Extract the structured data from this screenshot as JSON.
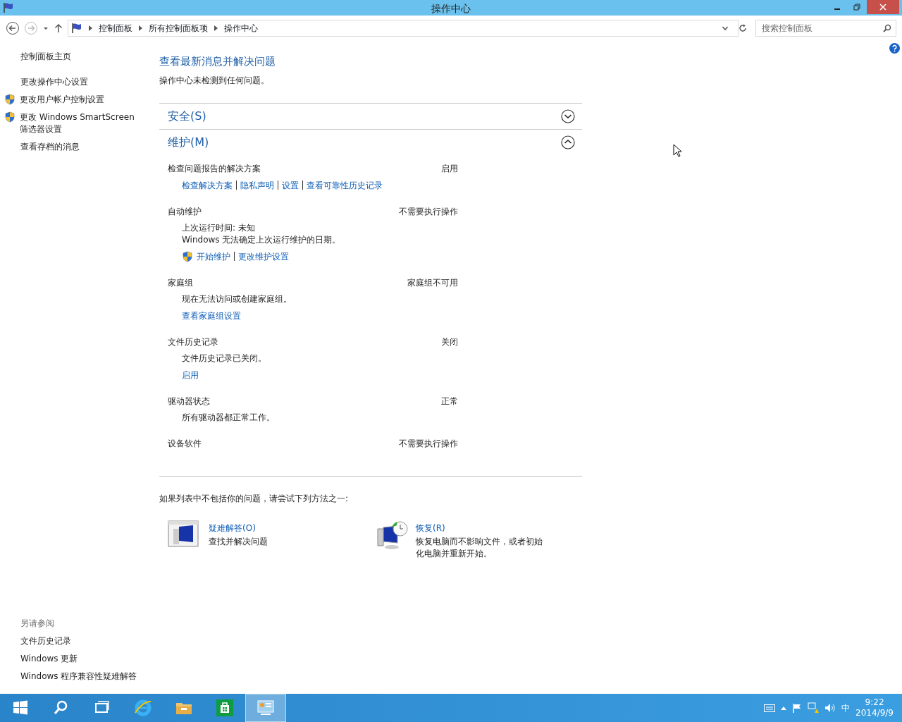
{
  "window": {
    "title": "操作中心"
  },
  "address_bar": {
    "crumbs": [
      "控制面板",
      "所有控制面板项",
      "操作中心"
    ]
  },
  "search": {
    "placeholder": "搜索控制面板"
  },
  "sidebar": {
    "home": "控制面板主页",
    "items": [
      {
        "label": "更改操作中心设置",
        "shield": false
      },
      {
        "label": "更改用户帐户控制设置",
        "shield": true
      },
      {
        "label": "更改 Windows SmartScreen 筛选器设置",
        "shield": true
      },
      {
        "label": "查看存档的消息",
        "shield": false
      }
    ],
    "see_also": {
      "title": "另请参阅",
      "items": [
        "文件历史记录",
        "Windows 更新",
        "Windows 程序兼容性疑难解答"
      ]
    }
  },
  "main": {
    "heading": "查看最新消息并解决问题",
    "subtitle": "操作中心未检测到任何问题。",
    "sections": [
      {
        "title": "安全(S)",
        "expanded": false
      },
      {
        "title": "维护(M)",
        "expanded": true,
        "items": [
          {
            "title": "检查问题报告的解决方案",
            "status": "启用",
            "links": [
              {
                "label": "检查解决方案",
                "shield": false
              },
              {
                "label": "隐私声明",
                "shield": false
              },
              {
                "label": "设置",
                "shield": false
              },
              {
                "label": "查看可靠性历史记录",
                "shield": false
              }
            ]
          },
          {
            "title": "自动维护",
            "status": "不需要执行操作",
            "lines": [
              "上次运行时间: 未知",
              "Windows 无法确定上次运行维护的日期。"
            ],
            "links": [
              {
                "label": "开始维护",
                "shield": true
              },
              {
                "label": "更改维护设置",
                "shield": false
              }
            ]
          },
          {
            "title": "家庭组",
            "status": "家庭组不可用",
            "lines": [
              "现在无法访问或创建家庭组。"
            ],
            "links": [
              {
                "label": "查看家庭组设置",
                "shield": false
              }
            ]
          },
          {
            "title": "文件历史记录",
            "status": "关闭",
            "lines": [
              "文件历史记录已关闭。"
            ],
            "links": [
              {
                "label": "启用",
                "shield": false
              }
            ]
          },
          {
            "title": "驱动器状态",
            "status": "正常",
            "lines": [
              "所有驱动器都正常工作。"
            ]
          },
          {
            "title": "设备软件",
            "status": "不需要执行操作"
          }
        ]
      }
    ],
    "try_text": "如果列表中不包括你的问题，请尝试下列方法之一:",
    "tools": [
      {
        "kind": "troubleshoot",
        "title": "疑难解答(O)",
        "description": "查找并解决问题"
      },
      {
        "kind": "recovery",
        "title": "恢复(R)",
        "description": "恢复电脑而不影响文件，或者初始化电脑并重新开始。"
      }
    ]
  },
  "taskbar": {
    "apps": [
      {
        "kind": "start",
        "selected": false
      },
      {
        "kind": "search",
        "selected": false
      },
      {
        "kind": "taskview",
        "selected": false
      },
      {
        "kind": "ie",
        "selected": false
      },
      {
        "kind": "explorer",
        "selected": false
      },
      {
        "kind": "store",
        "selected": false
      },
      {
        "kind": "controlpanel",
        "selected": true
      }
    ],
    "ime": "中",
    "time": "9:22",
    "date": "2014/9/9"
  }
}
